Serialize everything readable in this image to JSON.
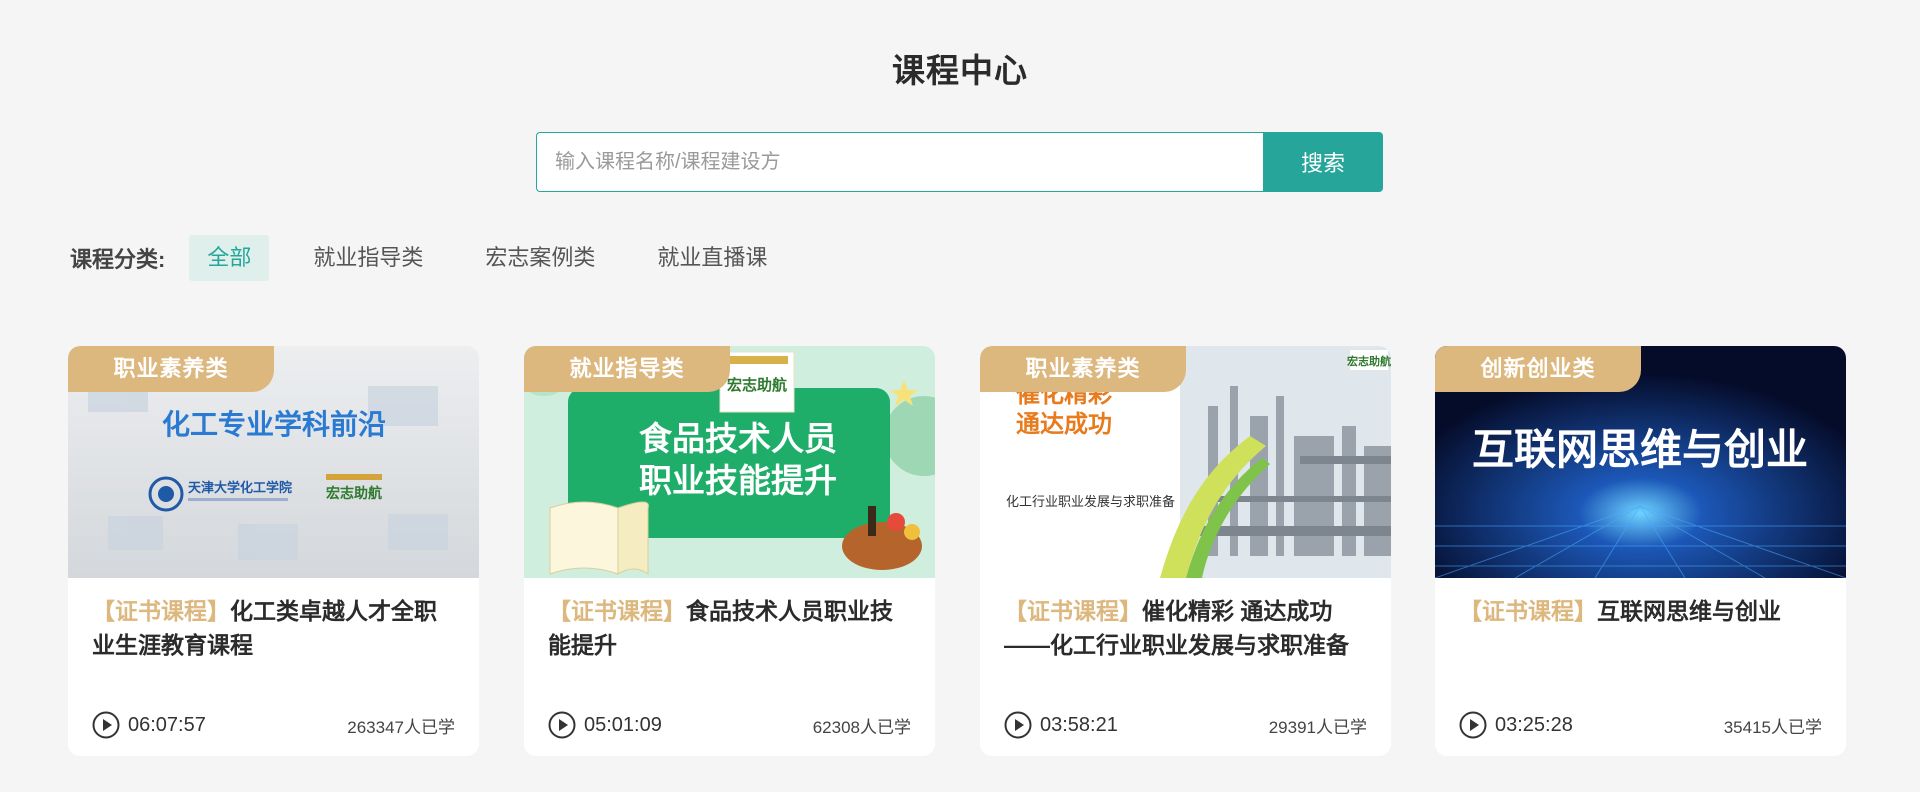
{
  "header": {
    "title": "课程中心"
  },
  "search": {
    "placeholder": "输入课程名称/课程建设方",
    "value": "",
    "button_label": "搜索"
  },
  "categories": {
    "label": "课程分类:",
    "tabs": [
      {
        "label": "全部",
        "active": true
      },
      {
        "label": "就业指导类",
        "active": false
      },
      {
        "label": "宏志案例类",
        "active": false
      },
      {
        "label": "就业直播课",
        "active": false
      }
    ]
  },
  "courses": [
    {
      "tag": "职业素养类",
      "title_prefix": "【证书课程】",
      "title": "化工类卓越人才全职业生涯教育课程",
      "duration": "06:07:57",
      "learners": "263347人已学",
      "thumb_text": {
        "headline": "化工专业学科前沿",
        "org": "天津大学化工学院",
        "logo": "宏志助航"
      }
    },
    {
      "tag": "就业指导类",
      "title_prefix": "【证书课程】",
      "title": "食品技术人员职业技能提升",
      "duration": "05:01:09",
      "learners": "62308人已学",
      "thumb_text": {
        "line1": "食品技术人员",
        "line2": "职业技能提升",
        "logo": "宏志助航"
      }
    },
    {
      "tag": "职业素养类",
      "title_prefix": "【证书课程】",
      "title": "催化精彩 通达成功——化工行业职业发展与求职准备",
      "duration": "03:58:21",
      "learners": "29391人已学",
      "thumb_text": {
        "line1": "催化精彩",
        "line2": "通达成功",
        "caption": "化工行业职业发展与求职准备",
        "logo": "宏志助航"
      }
    },
    {
      "tag": "创新创业类",
      "title_prefix": "【证书课程】",
      "title": "互联网思维与创业",
      "duration": "03:25:28",
      "learners": "35415人已学",
      "thumb_text": {
        "headline": "互联网思维与创业"
      }
    }
  ],
  "colors": {
    "accent": "#26a69a",
    "tag": "#dcb77e",
    "background": "#f4f5f4"
  }
}
